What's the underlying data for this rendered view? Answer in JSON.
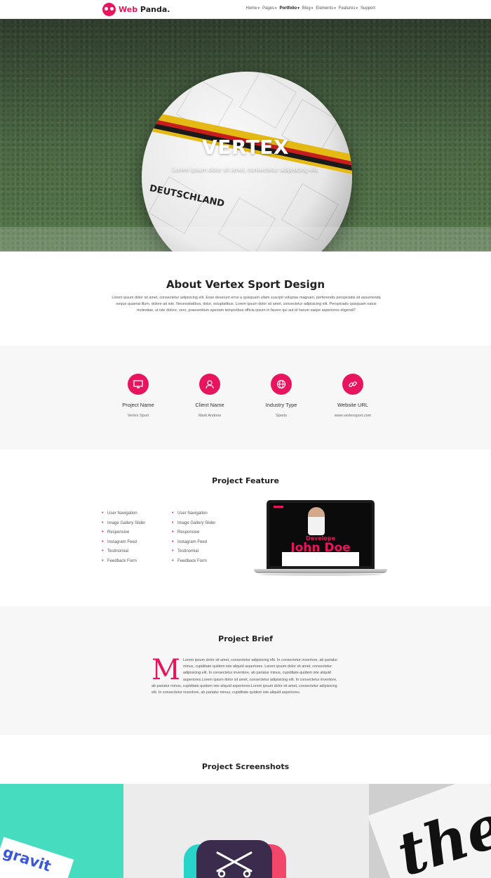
{
  "nav": {
    "logo_prefix": "Web",
    "logo_suffix": "Panda.",
    "items": [
      {
        "label": "Home",
        "caret": "▾"
      },
      {
        "label": "Pages",
        "caret": "▾"
      },
      {
        "label": "Portfolio",
        "caret": "▾"
      },
      {
        "label": "Blog",
        "caret": "▾"
      },
      {
        "label": "Elements",
        "caret": "▾"
      },
      {
        "label": "Features",
        "caret": "▾"
      },
      {
        "label": "Support",
        "caret": ""
      }
    ],
    "active_item": "Portfolio"
  },
  "hero": {
    "title": "VERTEX",
    "subtitle": "Lorem ipsum dolor sit amet, consectetur adipisicing elit.",
    "ball_text": "DEUTSCHLAND"
  },
  "about": {
    "title": "About Vertex Sport Design",
    "text": "Lorem ipsum dolor sit amet, consectetur adipisicing elit. Esse deserunt error a quisquam ullam suscipit voluptas magnam, perferendis perspiciatis sit assumenda neque quaerat illum, dolore ad iste. Necessitatibus, dolor, voluptatibus. Lorem ipsum dolor sit amet, consectetur adipisicing elit. Perspiciatis quisquam natus molestiae, ut iste dolore, vero, praesentium aperiam temporibus officia ipsum in facere qui aut id harum saepe asperiores eligendi?"
  },
  "info": [
    {
      "label": "Project Name",
      "value": "Vertex Sport",
      "icon": "monitor-icon"
    },
    {
      "label": "Client Name",
      "value": "Mark Andrew",
      "icon": "user-icon"
    },
    {
      "label": "Industry Type",
      "value": "Sports",
      "icon": "globe-icon"
    },
    {
      "label": "Website URL",
      "value": "www.vertexsport.com",
      "icon": "link-icon"
    }
  ],
  "feature": {
    "title": "Project Feature",
    "list_left": [
      "User Navigation",
      "Image Gallery Slider",
      "Responsive",
      "Instagram Feed",
      "Testinomial",
      "Feedback Form"
    ],
    "list_right": [
      "User Navigation",
      "Image Gallery Slider",
      "Responsive",
      "Instagram Feed",
      "Testinomial",
      "Feedback Form"
    ],
    "laptop_screen": {
      "role": "Develope",
      "name": "John Doe"
    }
  },
  "brief": {
    "title": "Project Brief",
    "dropcap": "M",
    "text": "Lorem ipsum dolor sit amet, consectetur adipisicing elit. In consectetur inventore, ab pariatur minus, cupiditate quidem iste aliquid asperiores. Lorem ipsum dolor sit amet, consectetur adipisicing elit. In consectetur inventore, ab pariatur minus, cupiditate quidem iste aliquid asperiores.Lorem ipsum dolor sit amet, consectetur adipisicing elit. In consectetur inventore, ab pariatur minus, cupiditate quidem iste aliquid asperiores.Lorem ipsum dolor sit amet, consectetur adipisicing elit. In consectetur inventore, ab pariatur minus, cupiditate quidem iste aliquid asperiores."
  },
  "screenshots": {
    "title": "Project Screenshots",
    "shot1_text": "gravit",
    "shot3_text": "the"
  },
  "colors": {
    "accent": "#e8155e"
  }
}
